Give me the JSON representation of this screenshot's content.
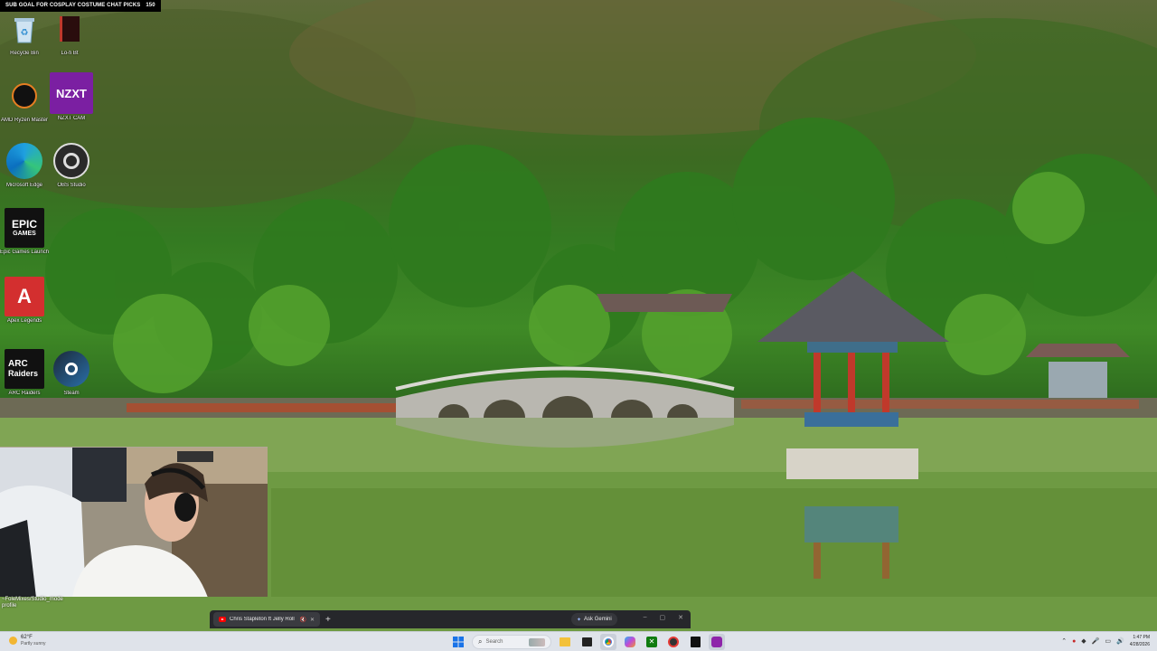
{
  "banner": {
    "text": "SUB GOAL FOR COSPLAY COSTUME CHAT PICKS",
    "count": "150"
  },
  "desktop_icons": [
    {
      "id": "recycle-bin",
      "label": "Recycle Bin"
    },
    {
      "id": "red-app",
      "label": "Lo-fi Bt"
    },
    {
      "id": "amd",
      "label": "AMD Ryzen Master"
    },
    {
      "id": "nzxt",
      "label": "NZXT CAM",
      "tile_text": "NZXT"
    },
    {
      "id": "edge",
      "label": "Microsoft Edge"
    },
    {
      "id": "obs",
      "label": "OBS Studio"
    },
    {
      "id": "epic",
      "label": "Epic Games Launcher",
      "tile_text_1": "EPIC",
      "tile_text_2": "GAMES"
    },
    {
      "id": "apex",
      "label": "Apex Legends"
    },
    {
      "id": "arc",
      "label": "ARC Raiders",
      "tile_text_1": "ARC",
      "tile_text_2": "Raiders"
    },
    {
      "id": "steam",
      "label": "Steam"
    }
  ],
  "webcam": {
    "caption": "~FoleMixes/Studio_mode\nprofile"
  },
  "browser": {
    "tab_title": "Chris Stapleton ft Jelly Roll",
    "new_tab": "+",
    "gemini_label": "Ask Gemini",
    "controls": [
      "–",
      "▢",
      "✕"
    ]
  },
  "taskbar": {
    "weather_temp": "62°F",
    "weather_desc": "Partly sunny",
    "search_placeholder": "Search",
    "time": "1:47 PM",
    "date": "4/28/2026"
  },
  "colors": {
    "taskbar_bg": "#dfe3ea",
    "tab_bg": "#26272b",
    "nzxt_purple": "#7b1fa2",
    "apex_red": "#d32f2f"
  }
}
